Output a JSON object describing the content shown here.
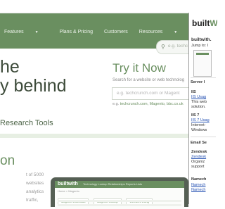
{
  "colors": {
    "brand_green": "#6a8f60",
    "link_blue": "#2753b3"
  },
  "navbar": {
    "items": [
      {
        "label": "Features",
        "caret": "▼"
      },
      {
        "label": "Plans & Pricing"
      },
      {
        "label": "Customers"
      },
      {
        "label": "Resources",
        "caret": "▼"
      }
    ],
    "search_placeholder": "e.g. techc",
    "search_icon": "search-icon"
  },
  "hero": {
    "line1": "he",
    "line2": "y behind",
    "subtitle": "Research Tools"
  },
  "tryit": {
    "title": "Try it Now",
    "caption": "Search for a website or web technolog",
    "placeholder": "e.g. techcrunch.com or Magent",
    "examples_prefix": "e.g. ",
    "examples_links": "techcrunch.com, Magento, bbc.co.uk"
  },
  "lower": {
    "heading": "on",
    "lines": [
      "t of 5000",
      "websites",
      "analytics",
      "traffic,"
    ]
  },
  "laptop": {
    "logo": "builtwith",
    "nav": "Technology Lookup   Relationships   Reports   Lists",
    "crumb": "Home > Magento",
    "tabs": [
      "Magento Download",
      "Magento Lookup",
      "Websites Using"
    ]
  },
  "panel": {
    "logo_prefix": "built",
    "logo_suffix": "W",
    "name": "builtwith.",
    "jump": "Jump to: I",
    "server_heading": "Server I",
    "iis_heading": "IIS",
    "iis_link": "IIS Usag",
    "iis_desc": [
      "This web",
      "solution."
    ],
    "iis7_heading": "IIS 7",
    "iis7_link": "IIS 7 Usag",
    "iis7_desc": [
      "Internet-",
      "Windows"
    ],
    "email_heading": "Email Se",
    "zendesk_heading": "Zendesk",
    "zendesk_link": "Zendesk",
    "zendesk_desc": [
      "Organiz",
      "support"
    ],
    "namecheap_heading": "Namech",
    "namecheap_links": [
      "Namech",
      "Namech"
    ]
  }
}
